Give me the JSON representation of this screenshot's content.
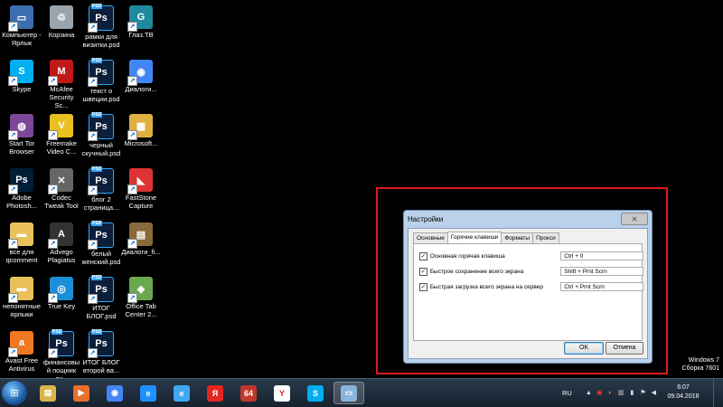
{
  "desktop": {
    "icons": [
      {
        "label": "Компьютер - Ярлык",
        "icon": "computer-icon"
      },
      {
        "label": "Корзина",
        "icon": "recycle-bin-icon"
      },
      {
        "label": "рамки для визитки.psd",
        "icon": "photoshop-file-icon"
      },
      {
        "label": "Глаз.ТВ",
        "icon": "glaz-tv-icon"
      },
      {
        "label": "Skype",
        "icon": "skype-icon"
      },
      {
        "label": "McAfee Security Sc...",
        "icon": "mcafee-icon"
      },
      {
        "label": "текст о швеции.psd",
        "icon": "photoshop-file-icon"
      },
      {
        "label": "Диалоги...",
        "icon": "chrome-icon"
      },
      {
        "label": "Start Tor Browser",
        "icon": "tor-browser-icon"
      },
      {
        "label": "Freemake Video C...",
        "icon": "freemake-icon"
      },
      {
        "label": "черный скучный.psd",
        "icon": "photoshop-file-icon"
      },
      {
        "label": "Microsoft...",
        "icon": "microsoft-folder-icon"
      },
      {
        "label": "Adobe Photosh...",
        "icon": "photoshop-app-icon"
      },
      {
        "label": "Codec Tweak Tool",
        "icon": "tools-icon"
      },
      {
        "label": "блог 2 страница...",
        "icon": "photoshop-file-icon"
      },
      {
        "label": "FastStone Capture",
        "icon": "faststone-icon"
      },
      {
        "label": "все для qcomment",
        "icon": "folder-icon"
      },
      {
        "label": "Advego Plagiatus",
        "icon": "advego-icon"
      },
      {
        "label": "белый женский.psd",
        "icon": "photoshop-file-icon"
      },
      {
        "label": "Диалоги_fi...",
        "icon": "movie-folder-icon"
      },
      {
        "label": "непонятные ярлыки",
        "icon": "folder-icon"
      },
      {
        "label": "True Key",
        "icon": "true-key-icon"
      },
      {
        "label": "ИТОГ БЛОГ.psd",
        "icon": "photoshop-file-icon"
      },
      {
        "label": "Office Tab Center 2...",
        "icon": "office-tab-icon"
      },
      {
        "label": "Avast Free Antivirus",
        "icon": "avast-icon"
      },
      {
        "label": "финансовый пощник ди...",
        "icon": "photoshop-file-icon"
      },
      {
        "label": "ИТОГ БЛОГ второй ва...",
        "icon": "photoshop-file-icon"
      }
    ]
  },
  "dialog": {
    "title": "Настройки",
    "close_glyph": "✕",
    "tabs": [
      "Основные",
      "Горячие клавиши",
      "Форматы",
      "Прокси"
    ],
    "active_tab": "Горячие клавиши",
    "hotkeys": [
      {
        "label": "Основная горячая клавиша",
        "value": "Ctrl + 0",
        "checked": true
      },
      {
        "label": "Быстрое сохранение всего экрана",
        "value": "Shift + Prnt Scrn",
        "checked": true
      },
      {
        "label": "Быстрая загрузка всего экрана на сервер",
        "value": "Ctrl + Prnt Scrn",
        "checked": true
      }
    ],
    "ok_label": "OK",
    "cancel_label": "Отмена"
  },
  "windows_info": {
    "line1": "Windows 7",
    "line2": "Сборка 7601"
  },
  "taskbar": {
    "items": [
      {
        "name": "explorer",
        "glyph": "▤"
      },
      {
        "name": "media-player",
        "glyph": "▶"
      },
      {
        "name": "chrome",
        "glyph": "◉"
      },
      {
        "name": "internet-explorer",
        "glyph": "e"
      },
      {
        "name": "capture",
        "glyph": "e"
      },
      {
        "name": "yandex",
        "glyph": "Я"
      },
      {
        "name": "app-64",
        "glyph": "64"
      },
      {
        "name": "yandex-browser",
        "glyph": "Y"
      },
      {
        "name": "skype",
        "glyph": "S"
      },
      {
        "name": "window",
        "glyph": "▭"
      }
    ],
    "language": "RU",
    "time": "6:07",
    "date": "09.04.2018"
  },
  "colors": {
    "highlight_frame": "#e0191b",
    "dialog_frame": "#b9d1ea"
  }
}
